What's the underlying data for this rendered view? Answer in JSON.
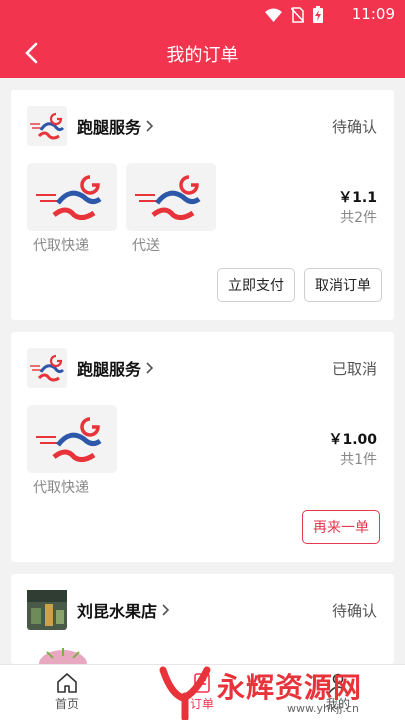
{
  "status_bar": {
    "time": "11:09"
  },
  "header": {
    "title": "我的订单"
  },
  "orders": [
    {
      "shop_name": "跑腿服务",
      "status": "待确认",
      "items": [
        {
          "name": "代取快递"
        },
        {
          "name": "代送"
        }
      ],
      "price": "￥1.1",
      "count": "共2件",
      "buttons": [
        "立即支付",
        "取消订单"
      ]
    },
    {
      "shop_name": "跑腿服务",
      "status": "已取消",
      "items": [
        {
          "name": "代取快递"
        }
      ],
      "price": "￥1.00",
      "count": "共1件",
      "buttons": [
        "再来一单"
      ]
    },
    {
      "shop_name": "刘昆水果店",
      "status": "待确认"
    }
  ],
  "tab_bar": {
    "tabs": [
      {
        "label": "首页"
      },
      {
        "label": "订单"
      },
      {
        "label": "我的"
      }
    ]
  },
  "watermark": {
    "text": "永辉资源网",
    "url": "www.yhkjj.cn"
  },
  "colors": {
    "brand": "#f2344f",
    "accent_red": "#e33a4f"
  }
}
